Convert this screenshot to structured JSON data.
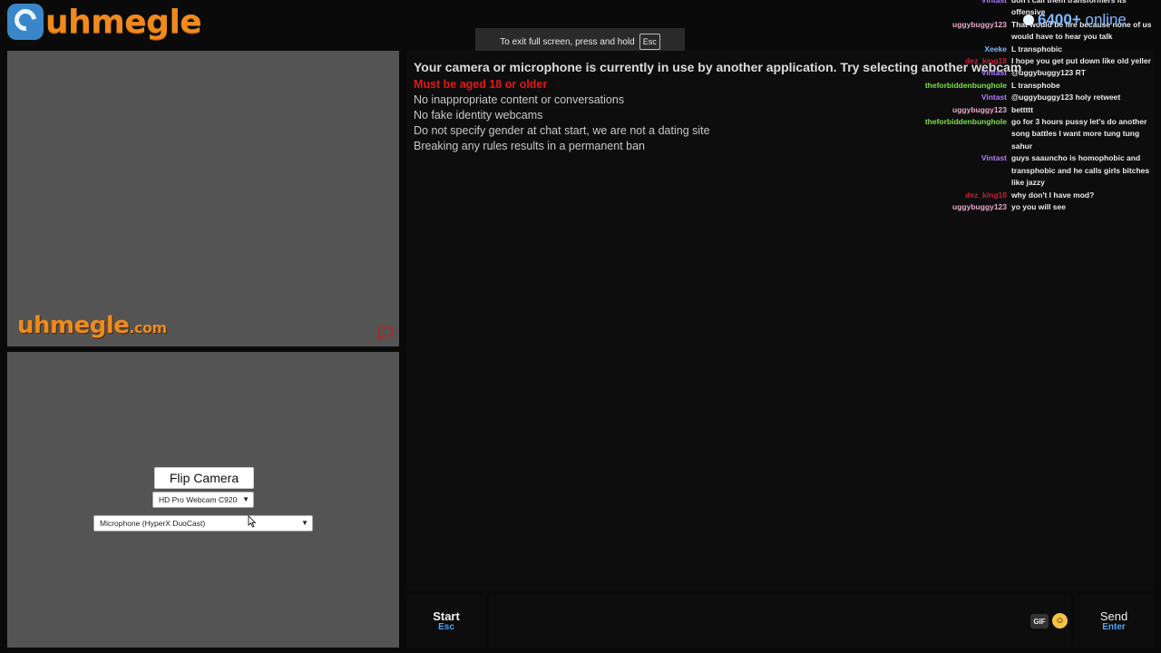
{
  "brand": {
    "logo_text": "uhmegle",
    "watermark_main": "uhmegle",
    "watermark_suffix": ".com"
  },
  "fullscreen_hint": {
    "text": "To exit full screen, press and hold",
    "key": "Esc"
  },
  "online": {
    "count": "6400+",
    "label": "online"
  },
  "camera_error": "Your camera or microphone is currently in use by another application. Try selecting another webcam",
  "rules": [
    "Must be aged 18 or older",
    "No inappropriate content or conversations",
    "No fake identity webcams",
    "Do not specify gender at chat start, we are not a dating site",
    "Breaking any rules results in a permanent ban"
  ],
  "self_video": {
    "flip_label": "Flip Camera",
    "camera_select": "HD Pro Webcam C920",
    "mic_select": "Microphone (HyperX DuoCast)"
  },
  "bottom": {
    "start_label": "Start",
    "start_key": "Esc",
    "gif_label": "GIF",
    "send_label": "Send",
    "send_key": "Enter"
  },
  "chat_feed": [
    {
      "user": "Vintast",
      "color": "#b07cff",
      "text": "don't call them transformers its offensive"
    },
    {
      "user": "uggybuggy123",
      "color": "#e8a8c8",
      "text": "That would be fire because none of us would have to hear you talk"
    },
    {
      "user": "Xeeke",
      "color": "#7ab8ff",
      "text": "L transphobic"
    },
    {
      "user": "dez_king18",
      "color": "#c8203a",
      "text": "I hope you get put down like old yeller"
    },
    {
      "user": "Vintast",
      "color": "#b07cff",
      "text": "@uggybuggy123 RT"
    },
    {
      "user": "theforbiddenbunghole",
      "color": "#7be04a",
      "text": "L transphobe"
    },
    {
      "user": "Vintast",
      "color": "#b07cff",
      "text": "@uggybuggy123 holy retweet"
    },
    {
      "user": "uggybuggy123",
      "color": "#e8a8c8",
      "text": "bettttt"
    },
    {
      "user": "theforbiddenbunghole",
      "color": "#7be04a",
      "text": "go for 3 hours pussy let's do another song battles I want more tung tung sahur"
    },
    {
      "user": "Vintast",
      "color": "#b07cff",
      "text": "guys saauncho is homophobic and transphobic and he calls girls bitches like jazzy"
    },
    {
      "user": "dez_king18",
      "color": "#c8203a",
      "text": "why don't I have mod?"
    },
    {
      "user": "uggybuggy123",
      "color": "#e8a8c8",
      "text": "yo you will see"
    }
  ]
}
